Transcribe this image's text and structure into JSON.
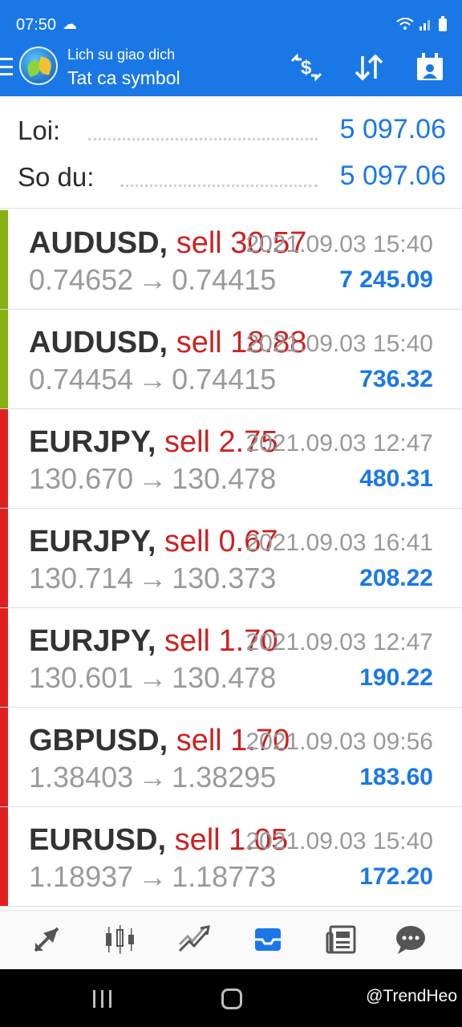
{
  "status_bar": {
    "time": "07:50",
    "weather_icon": "sun-cloud-icon",
    "icons": [
      "wifi-icon",
      "signal-icon",
      "battery-icon"
    ]
  },
  "app_bar": {
    "subtitle": "Lich su giao dich",
    "title": "Tat ca symbol",
    "actions": [
      "currency-exchange-icon",
      "sort-icon",
      "calendar-icon"
    ]
  },
  "summary": {
    "profit_label": "Loi:",
    "profit_value": "5 097.06",
    "balance_label": "So du:",
    "balance_value": "5 097.06"
  },
  "deals": [
    {
      "symbol": "AUDUSD,",
      "side": "sell 30.57",
      "date": "2021.09.03 15:40",
      "open": "0.74652",
      "close": "0.74415",
      "profit": "7 245.09",
      "bar_color": "#86b214"
    },
    {
      "symbol": "AUDUSD,",
      "side": "sell 18.88",
      "date": "2021.09.03 15:40",
      "open": "0.74454",
      "close": "0.74415",
      "profit": "736.32",
      "bar_color": "#86b214"
    },
    {
      "symbol": "EURJPY,",
      "side": "sell 2.75",
      "date": "2021.09.03 12:47",
      "open": "130.670",
      "close": "130.478",
      "profit": "480.31",
      "bar_color": "#e02020"
    },
    {
      "symbol": "EURJPY,",
      "side": "sell 0.67",
      "date": "2021.09.03 16:41",
      "open": "130.714",
      "close": "130.373",
      "profit": "208.22",
      "bar_color": "#e02020"
    },
    {
      "symbol": "EURJPY,",
      "side": "sell 1.70",
      "date": "2021.09.03 12:47",
      "open": "130.601",
      "close": "130.478",
      "profit": "190.22",
      "bar_color": "#e02020"
    },
    {
      "symbol": "GBPUSD,",
      "side": "sell 1.70",
      "date": "2021.09.03 09:56",
      "open": "1.38403",
      "close": "1.38295",
      "profit": "183.60",
      "bar_color": "#e02020"
    },
    {
      "symbol": "EURUSD,",
      "side": "sell 1.05",
      "date": "2021.09.03 15:40",
      "open": "1.18937",
      "close": "1.18773",
      "profit": "172.20",
      "bar_color": "#e02020"
    }
  ],
  "arrow": "→",
  "bottom_nav": [
    "quotes-icon",
    "chart-candles-icon",
    "trade-icon",
    "history-icon",
    "news-icon",
    "chat-icon"
  ],
  "colors": {
    "accent": "#1a78e6",
    "active_nav": "#1a78e6",
    "inactive_nav": "#555555"
  },
  "watermark": "@TrendHeo"
}
